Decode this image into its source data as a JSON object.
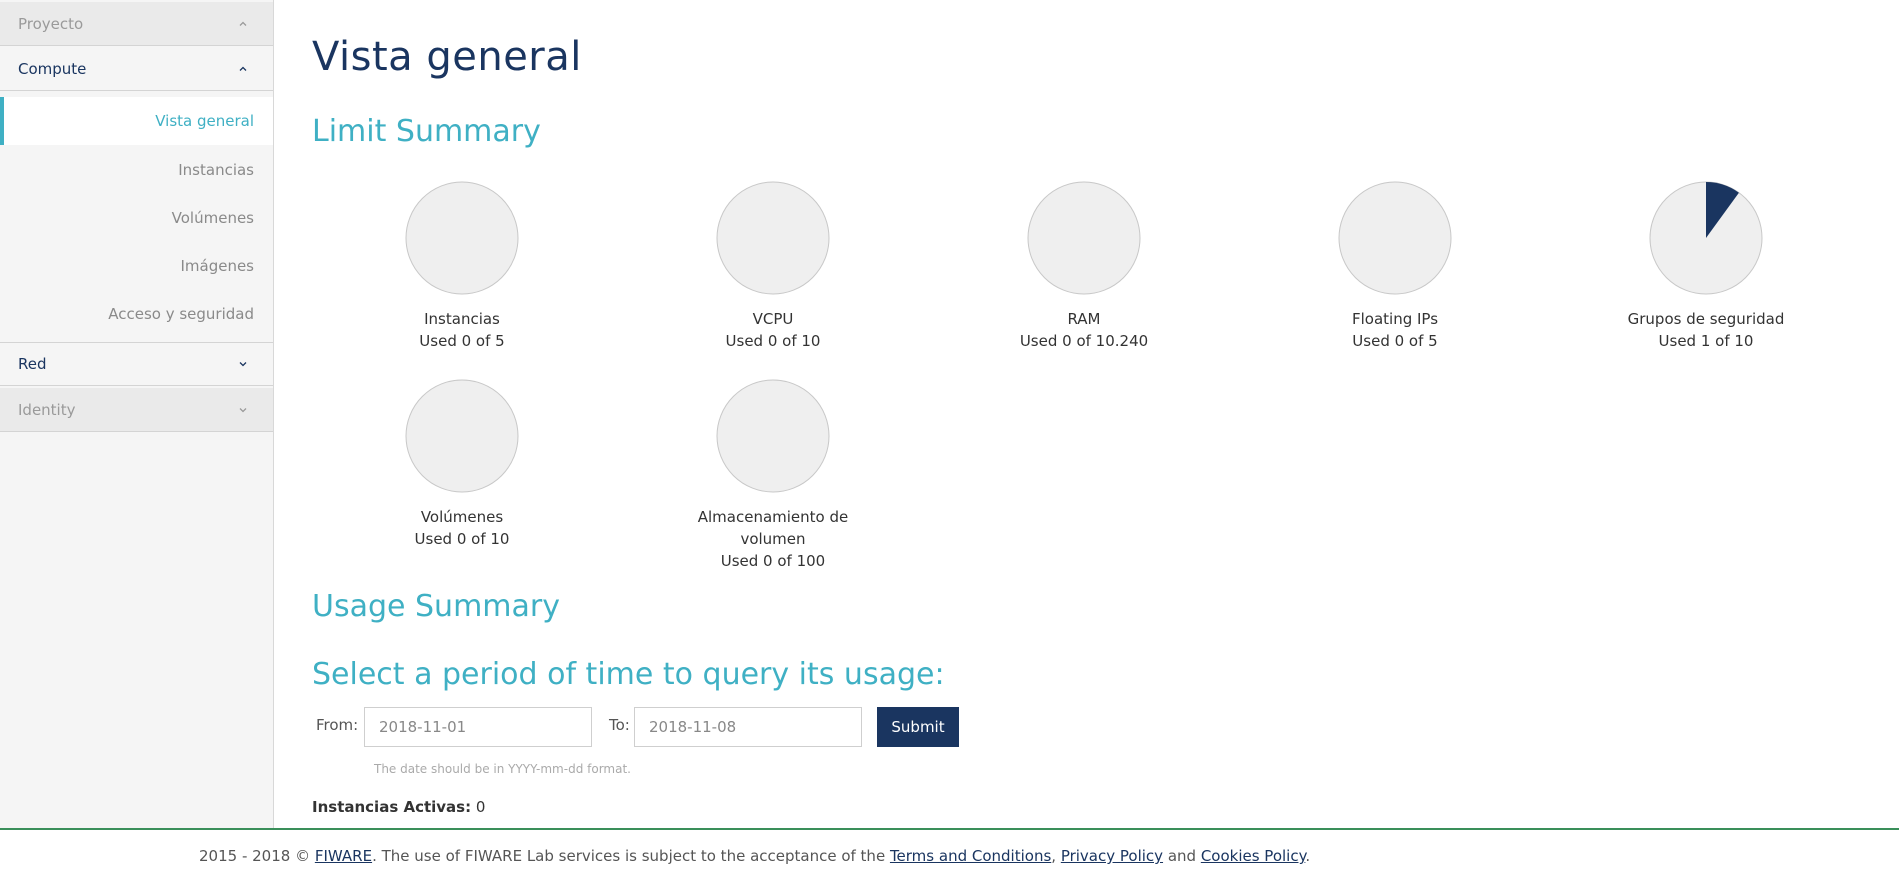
{
  "sidebar": {
    "sections": [
      {
        "label": "Proyecto"
      },
      {
        "label": "Compute"
      },
      {
        "label": "Red"
      },
      {
        "label": "Identity"
      }
    ],
    "compute_items": [
      {
        "label": "Vista general"
      },
      {
        "label": "Instancias"
      },
      {
        "label": "Volúmenes"
      },
      {
        "label": "Imágenes"
      },
      {
        "label": "Acceso y seguridad"
      }
    ]
  },
  "main": {
    "title": "Vista general",
    "limit_summary_title": "Limit Summary",
    "usage_summary_title": "Usage Summary",
    "query_title": "Select a period of time to query its usage:"
  },
  "chart_data": {
    "type": "pie",
    "charts": [
      {
        "name": "Instancias",
        "used_label": "Used 0 of 5",
        "used": 0,
        "limit": 5
      },
      {
        "name": "VCPU",
        "used_label": "Used 0 of 10",
        "used": 0,
        "limit": 10
      },
      {
        "name": "RAM",
        "used_label": "Used 0 of 10.240",
        "used": 0,
        "limit": 10240
      },
      {
        "name": "Floating IPs",
        "used_label": "Used 0 of 5",
        "used": 0,
        "limit": 5
      },
      {
        "name": "Grupos de seguridad",
        "used_label": "Used 1 of 10",
        "used": 1,
        "limit": 10
      },
      {
        "name": "Volúmenes",
        "used_label": "Used 0 of 10",
        "used": 0,
        "limit": 10
      },
      {
        "name": "Almacenamiento de volumen",
        "used_label": "Used 0 of 100",
        "used": 0,
        "limit": 100
      }
    ],
    "colors": {
      "used": "#1a3560",
      "free": "#efefef",
      "stroke": "#c8c8c8"
    }
  },
  "form": {
    "from_label": "From:",
    "from_value": "2018-11-01",
    "to_label": "To:",
    "to_value": "2018-11-08",
    "submit_label": "Submit",
    "help": "The date should be in YYYY-mm-dd format."
  },
  "stats": {
    "active_instances_label": "Instancias Activas:",
    "active_instances_value": "0"
  },
  "footer": {
    "prefix": "2015 - 2018 © ",
    "fiware_link": "FIWARE",
    "middle": ". The use of FIWARE Lab services is subject to the acceptance of the ",
    "terms_link": "Terms and Conditions",
    "sep1": ", ",
    "privacy_link": "Privacy Policy",
    "sep2": " and ",
    "cookies_link": "Cookies Policy",
    "suffix": "."
  },
  "colors": {
    "accent": "#3fb0c4",
    "brand": "#1a3560"
  }
}
